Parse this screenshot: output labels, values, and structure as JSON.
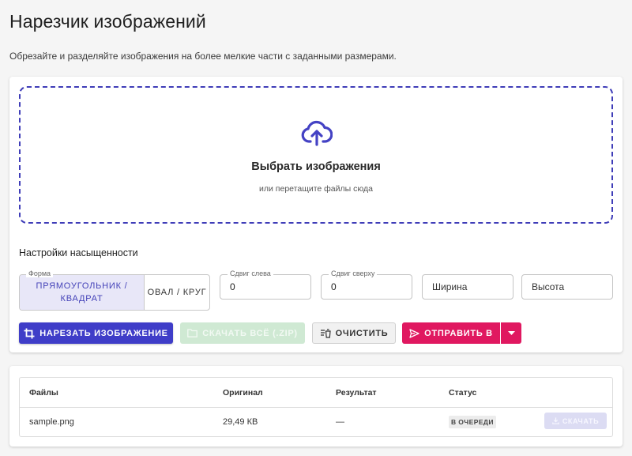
{
  "page": {
    "title": "Нарезчик изображений",
    "subtitle": "Обрезайте и разделяйте изображения на более мелкие части с заданными размерами."
  },
  "dropzone": {
    "title": "Выбрать изображения",
    "hint": "или перетащите файлы сюда",
    "icon": "cloud-upload-icon"
  },
  "settings": {
    "title": "Настройки насыщенности",
    "shape": {
      "legend": "Форма",
      "options": [
        "ПРЯМОУГОЛЬНИК / КВАДРАТ",
        "ОВАЛ / КРУГ"
      ],
      "selected": "ПРЯМОУГОЛЬНИК / КВАДРАТ"
    },
    "offset_left": {
      "label": "Сдвиг слева",
      "value": "0"
    },
    "offset_top": {
      "label": "Сдвиг сверху",
      "value": "0"
    },
    "width": {
      "placeholder": "Ширина",
      "value": ""
    },
    "height": {
      "placeholder": "Высота",
      "value": ""
    }
  },
  "actions": {
    "crop": "НАРЕЗАТЬ ИЗОБРАЖЕНИЕ",
    "download_zip": "СКАЧАТЬ ВСЁ (.ZIP)",
    "clear": "ОЧИСТИТЬ",
    "send": "ОТПРАВИТЬ В"
  },
  "files_table": {
    "headers": [
      "Файлы",
      "Оригинал",
      "Результат",
      "Статус"
    ],
    "rows": [
      {
        "file": "sample.png",
        "original": "29,49 КВ",
        "result": "—",
        "status": "В ОЧЕРЕДИ",
        "action": "СКАЧАТЬ"
      }
    ]
  },
  "colors": {
    "primary": "#3f3dc8",
    "accent": "#e01860",
    "success_disabled": "#cfe9d3",
    "selected_option_bg": "#e8e7f8"
  }
}
